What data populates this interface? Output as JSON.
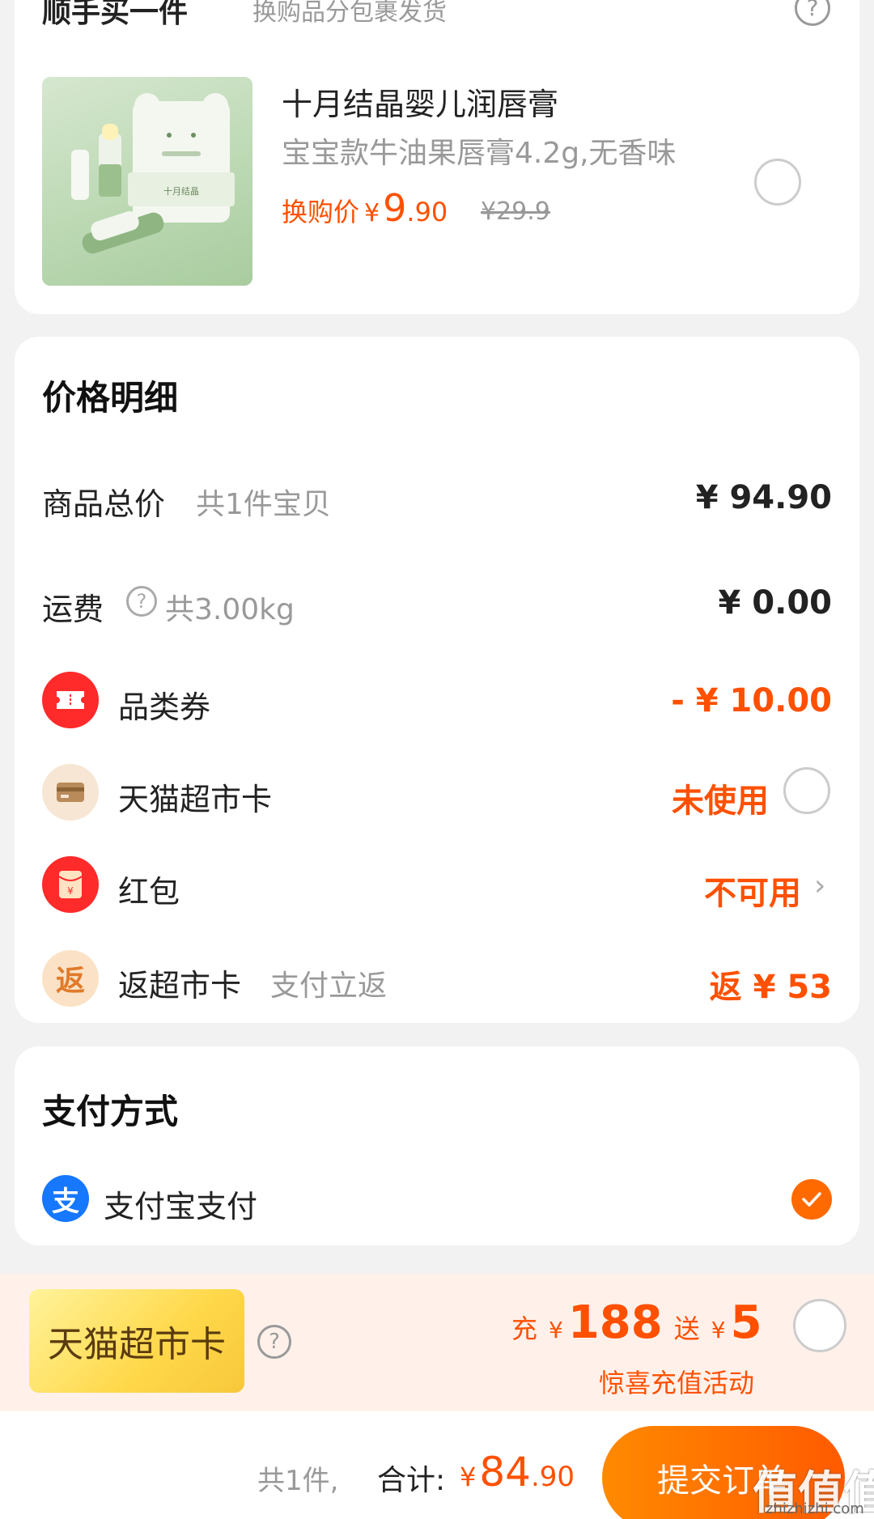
{
  "addon": {
    "title": "顺手买一件",
    "subtitle": "换购品分包裹发货",
    "product": {
      "name": "十月结晶婴儿润唇膏",
      "spec": "宝宝款牛油果唇膏4.2g,无香味",
      "price_label": "换购价",
      "currency": "¥",
      "price_int": "9",
      "price_dec": ".90",
      "original_price": "¥29.9",
      "brand_on_box": "十月结晶"
    }
  },
  "price_detail": {
    "title": "价格明细",
    "goods_total": {
      "label": "商品总价",
      "hint": "共1件宝贝",
      "value": "¥ 94.90"
    },
    "shipping": {
      "label": "运费",
      "hint": "共3.00kg",
      "value": "¥ 0.00"
    },
    "coupon": {
      "label": "品类券",
      "value": "- ¥ 10.00"
    },
    "tmall_card": {
      "label": "天猫超市卡",
      "value": "未使用"
    },
    "red_packet": {
      "label": "红包",
      "value": "不可用"
    },
    "cashback": {
      "label": "返超市卡",
      "hint": "支付立返",
      "value": "返 ¥ 53",
      "icon_char": "返"
    }
  },
  "payment": {
    "title": "支付方式",
    "method": "支付宝支付",
    "icon_char": "支"
  },
  "promo": {
    "card_label": "天猫超市卡",
    "recharge_prefix": "充",
    "recharge_currency": "¥",
    "recharge_amount": "188",
    "bonus_prefix": "送",
    "bonus_currency": "¥",
    "bonus_amount": "5",
    "desc": "惊喜充值活动"
  },
  "bottom": {
    "count": "共1件,",
    "total_label": "合计:",
    "currency": "¥",
    "total_int": "84",
    "total_dec": ".90",
    "submit": "提交订单"
  },
  "watermark": {
    "logo": "值值值",
    "url": "zhizhizhi.com"
  },
  "colors": {
    "accent": "#ff5000",
    "coupon_red": "#ff2a2a",
    "alipay_blue": "#1677ff"
  }
}
